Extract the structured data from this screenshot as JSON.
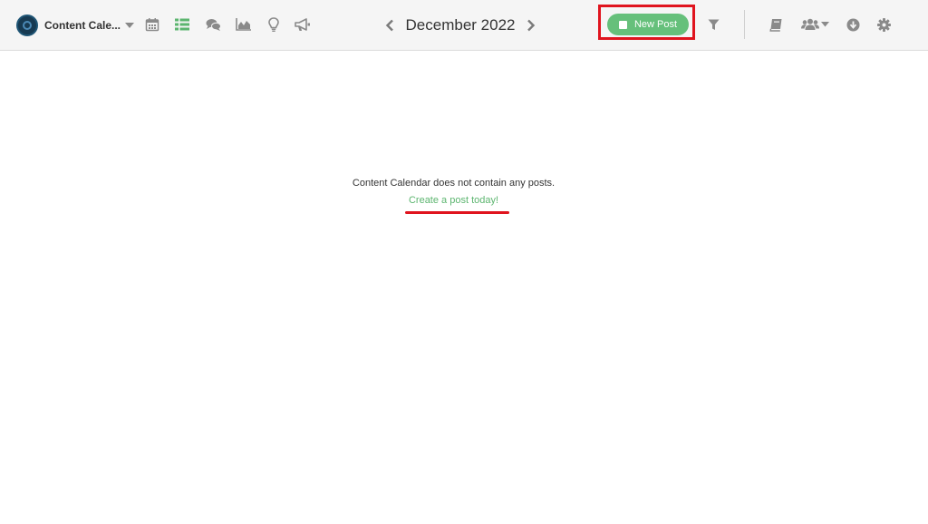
{
  "header": {
    "workspace_name": "Content Cale...",
    "month_label": "December 2022",
    "new_post_label": "New Post"
  },
  "toolbar_icons": [
    "calendar-icon",
    "list-icon",
    "comments-icon",
    "chart-icon",
    "lightbulb-icon",
    "bullhorn-icon"
  ],
  "right_icons": [
    "filter-icon",
    "book-icon",
    "users-icon",
    "download-icon",
    "gear-icon"
  ],
  "colors": {
    "accent_green": "#66c07b",
    "link_green": "#5cb56f",
    "annotation_red": "#e0141e",
    "icon_gray": "#8a8a8a"
  },
  "empty_state": {
    "message": "Content Calendar does not contain any posts.",
    "link_text": "Create a post today!"
  }
}
